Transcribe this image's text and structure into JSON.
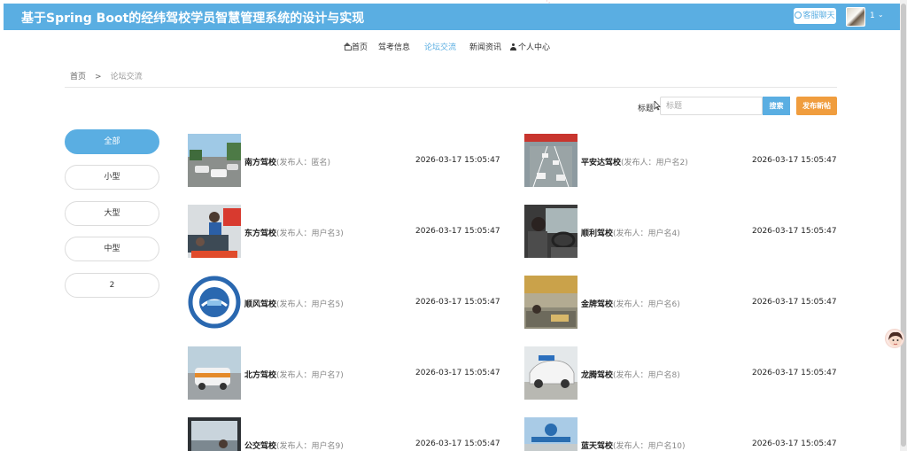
{
  "app": {
    "title": "基于Spring Boot的经纬驾校学员智慧管理系统的设计与实现",
    "chat_label": "客服聊天",
    "user_name": "1",
    "user_caret": "⌄"
  },
  "nav": {
    "items": [
      {
        "label": "首页",
        "icon": "home-icon",
        "active": false
      },
      {
        "label": "驾考信息",
        "icon": "",
        "active": false
      },
      {
        "label": "论坛交流",
        "icon": "",
        "active": true
      },
      {
        "label": "新闻资讯",
        "icon": "",
        "active": false
      },
      {
        "label": "个人中心",
        "icon": "person-icon",
        "active": false
      }
    ]
  },
  "breadcrumb": {
    "home": "首页",
    "separator": ">",
    "current": "论坛交流"
  },
  "search": {
    "label": "标题",
    "placeholder": "标题",
    "value": "",
    "button": "搜索",
    "publish": "发布新帖"
  },
  "categories": [
    {
      "label": "全部",
      "active": true
    },
    {
      "label": "小型",
      "active": false
    },
    {
      "label": "大型",
      "active": false
    },
    {
      "label": "中型",
      "active": false
    },
    {
      "label": "2",
      "active": false
    }
  ],
  "posts": [
    {
      "title": "南方驾校",
      "author": "(发布人：匿名)",
      "time": "2026-03-17 15:05:47"
    },
    {
      "title": "平安达驾校",
      "author": "(发布人：用户名2)",
      "time": "2026-03-17 15:05:47"
    },
    {
      "title": "东方驾校",
      "author": "(发布人：用户名3)",
      "time": "2026-03-17 15:05:47"
    },
    {
      "title": "顺利驾校",
      "author": "(发布人：用户名4)",
      "time": "2026-03-17 15:05:47"
    },
    {
      "title": "顺风驾校",
      "author": "(发布人：用户名5)",
      "time": "2026-03-17 15:05:47"
    },
    {
      "title": "金牌驾校",
      "author": "(发布人：用户名6)",
      "time": "2026-03-17 15:05:47"
    },
    {
      "title": "北方驾校",
      "author": "(发布人：用户名7)",
      "time": "2026-03-17 15:05:47"
    },
    {
      "title": "龙腾驾校",
      "author": "(发布人：用户名8)",
      "time": "2026-03-17 15:05:47"
    },
    {
      "title": "公交驾校",
      "author": "(发布人：用户名9)",
      "time": "2026-03-17 15:05:47"
    },
    {
      "title": "蓝天驾校",
      "author": "(发布人：用户名10)",
      "time": "2026-03-17 15:05:47"
    }
  ],
  "colors": {
    "primary": "#5aaee2",
    "publish": "#f09d3e"
  }
}
